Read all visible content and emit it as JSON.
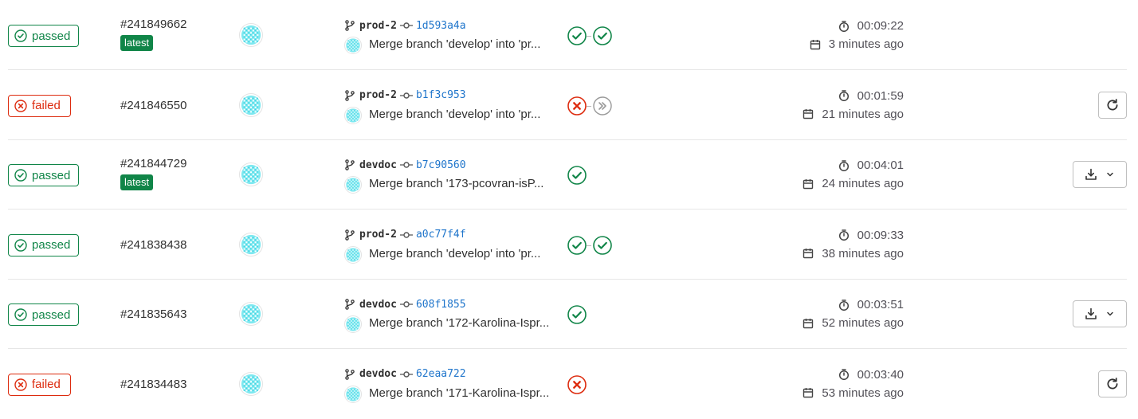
{
  "pipelines": [
    {
      "status": "passed",
      "id": "#241849662",
      "latest": "latest",
      "branch": "prod-2",
      "sha": "1d593a4a",
      "message": "Merge branch 'develop' into 'pr...",
      "stages": [
        "success",
        "success"
      ],
      "duration": "00:09:22",
      "finished": "3 minutes ago",
      "action": ""
    },
    {
      "status": "failed",
      "id": "#241846550",
      "latest": "",
      "branch": "prod-2",
      "sha": "b1f3c953",
      "message": "Merge branch 'develop' into 'pr...",
      "stages": [
        "failed",
        "skipped"
      ],
      "duration": "00:01:59",
      "finished": "21 minutes ago",
      "action": "retry"
    },
    {
      "status": "passed",
      "id": "#241844729",
      "latest": "latest",
      "branch": "devdoc",
      "sha": "b7c90560",
      "message": "Merge branch '173-pcovran-isP...",
      "stages": [
        "success"
      ],
      "duration": "00:04:01",
      "finished": "24 minutes ago",
      "action": "download"
    },
    {
      "status": "passed",
      "id": "#241838438",
      "latest": "",
      "branch": "prod-2",
      "sha": "a0c77f4f",
      "message": "Merge branch 'develop' into 'pr...",
      "stages": [
        "success",
        "success"
      ],
      "duration": "00:09:33",
      "finished": "38 minutes ago",
      "action": ""
    },
    {
      "status": "passed",
      "id": "#241835643",
      "latest": "",
      "branch": "devdoc",
      "sha": "608f1855",
      "message": "Merge branch '172-Karolina-Ispr...",
      "stages": [
        "success"
      ],
      "duration": "00:03:51",
      "finished": "52 minutes ago",
      "action": "download"
    },
    {
      "status": "failed",
      "id": "#241834483",
      "latest": "",
      "branch": "devdoc",
      "sha": "62eaa722",
      "message": "Merge branch '171-Karolina-Ispr...",
      "stages": [
        "failed"
      ],
      "duration": "00:03:40",
      "finished": "53 minutes ago",
      "action": "retry"
    }
  ],
  "icons": {
    "passed": "status-success-icon",
    "failed": "status-failed-icon",
    "branch": "branch-icon",
    "commit": "commit-icon",
    "timer": "timer-icon",
    "calendar": "calendar-icon",
    "retry": "retry-icon",
    "download": "download-icon",
    "chevron": "chevron-down-icon",
    "skipped": "status-skipped-icon"
  },
  "colors": {
    "success": "#108548",
    "failed": "#dd2b0e",
    "link": "#1f75cb",
    "skipped": "#999999"
  }
}
